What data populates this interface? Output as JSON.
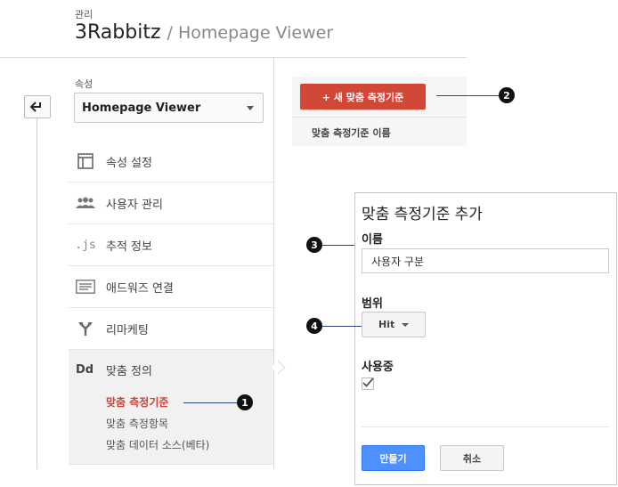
{
  "header": {
    "section": "관리",
    "account": "3Rabbitz",
    "separator": "/",
    "property": "Homepage Viewer"
  },
  "property_selector": {
    "label": "속성",
    "value": "Homepage Viewer"
  },
  "nav": {
    "items": [
      {
        "label": "속성 설정",
        "icon": "window-icon"
      },
      {
        "label": "사용자 관리",
        "icon": "users-icon"
      },
      {
        "label": "추적 정보",
        "icon": "js-icon"
      },
      {
        "label": "애드워즈 연결",
        "icon": "adwords-icon"
      },
      {
        "label": "리마케팅",
        "icon": "remarketing-icon"
      }
    ],
    "custom": {
      "icon_text": "Dd",
      "label": "맞춤 정의",
      "sub_items": [
        {
          "label": "맞춤 측정기준",
          "active": true
        },
        {
          "label": "맞춤 측정항목",
          "active": false
        },
        {
          "label": "맞춤 데이터 소스(베타)",
          "active": false
        }
      ]
    }
  },
  "content": {
    "new_button": "+ 새 맞춤 측정기준",
    "column_header": "맞춤 측정기준 이름"
  },
  "dialog": {
    "title": "맞춤 측정기준 추가",
    "name_label": "이름",
    "name_value": "사용자 구분",
    "scope_label": "범위",
    "scope_value": "Hit",
    "active_label": "사용중",
    "active_checked": true,
    "create_button": "만들기",
    "cancel_button": "취소"
  },
  "callouts": [
    "1",
    "2",
    "3",
    "4"
  ],
  "colors": {
    "primary_red": "#d14836",
    "active_link": "#d23f31",
    "primary_blue": "#4d90fe"
  }
}
